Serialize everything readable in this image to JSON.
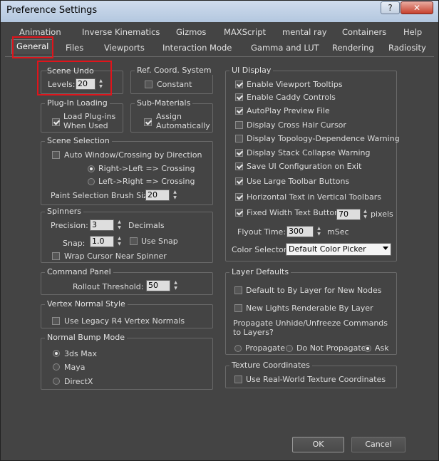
{
  "window": {
    "title": "Preference Settings",
    "help_label": "?",
    "close_label": "✕"
  },
  "tabs": {
    "row1": [
      "Animation",
      "Inverse Kinematics",
      "Gizmos",
      "MAXScript",
      "mental ray",
      "Containers",
      "Help"
    ],
    "row2": [
      "General",
      "Files",
      "Viewports",
      "Interaction Mode",
      "Gamma and LUT",
      "Rendering",
      "Radiosity"
    ]
  },
  "scene_undo": {
    "title": "Scene Undo",
    "levels_label": "Levels:",
    "levels_value": "20"
  },
  "ref_coord": {
    "title": "Ref. Coord. System",
    "constant_label": "Constant",
    "constant_checked": false
  },
  "plugin_loading": {
    "title": "Plug-In Loading",
    "load_label": "Load Plug-ins\nWhen Used",
    "load_line1": "Load Plug-ins",
    "load_line2": "When Used",
    "load_checked": true
  },
  "sub_materials": {
    "title": "Sub-Materials",
    "assign_line1": "Assign",
    "assign_line2": "Automatically",
    "assign_checked": true
  },
  "scene_selection": {
    "title": "Scene Selection",
    "auto_window_label": "Auto Window/Crossing by Direction",
    "auto_window_checked": false,
    "rtl_label": "Right->Left => Crossing",
    "ltr_label": "Left->Right => Crossing",
    "selected": "rtl",
    "paint_brush_label": "Paint Selection Brush Size",
    "paint_brush_value": "20"
  },
  "spinners": {
    "title": "Spinners",
    "precision_label": "Precision:",
    "precision_value": "3",
    "decimals_label": "Decimals",
    "snap_label": "Snap:",
    "snap_value": "1.0",
    "use_snap_label": "Use Snap",
    "use_snap_checked": false,
    "wrap_label": "Wrap Cursor Near Spinner",
    "wrap_checked": false
  },
  "command_panel": {
    "title": "Command Panel",
    "rollout_label": "Rollout Threshold:",
    "rollout_value": "50"
  },
  "vertex_normal": {
    "title": "Vertex Normal Style",
    "legacy_label": "Use Legacy R4 Vertex Normals",
    "legacy_checked": false
  },
  "normal_bump": {
    "title": "Normal Bump Mode",
    "options": [
      "3ds Max",
      "Maya",
      "DirectX"
    ],
    "selected_index": 0
  },
  "ui_display": {
    "title": "UI Display",
    "items": [
      {
        "label": "Enable Viewport Tooltips",
        "checked": true
      },
      {
        "label": "Enable Caddy Controls",
        "checked": true
      },
      {
        "label": "AutoPlay Preview File",
        "checked": true
      },
      {
        "label": "Display Cross Hair Cursor",
        "checked": false
      },
      {
        "label": "Display Topology-Dependence Warning",
        "checked": false
      },
      {
        "label": "Display Stack Collapse Warning",
        "checked": true
      },
      {
        "label": "Save UI Configuration on Exit",
        "checked": true
      },
      {
        "label": "Use Large Toolbar Buttons",
        "checked": true
      },
      {
        "label": "Horizontal Text in Vertical Toolbars",
        "checked": true
      }
    ],
    "fixed_width_label": "Fixed Width Text Buttons:",
    "fixed_width_checked": true,
    "fixed_width_value": "70",
    "pixels_label": "pixels",
    "flyout_label": "Flyout Time:",
    "flyout_value": "300",
    "msec_label": "mSec",
    "color_selector_label": "Color Selector:",
    "color_selector_value": "Default Color Picker"
  },
  "layer_defaults": {
    "title": "Layer Defaults",
    "default_bylayer_label": "Default to By Layer for New Nodes",
    "default_bylayer_checked": false,
    "new_lights_label": "New Lights Renderable By Layer",
    "new_lights_checked": false,
    "propagate_line1": "Propagate Unhide/Unfreeze Commands",
    "propagate_line2": "to Layers?",
    "propagate_options": [
      "Propagate",
      "Do Not Propagate",
      "Ask"
    ],
    "propagate_selected": 2
  },
  "texture_coords": {
    "title": "Texture Coordinates",
    "real_world_label": "Use Real-World Texture Coordinates",
    "real_world_checked": false
  },
  "footer": {
    "ok_label": "OK",
    "cancel_label": "Cancel"
  },
  "colors": {
    "dialog_bg": "#444444",
    "highlight": "#e0141b",
    "title_bar": "#c4d4e8"
  }
}
